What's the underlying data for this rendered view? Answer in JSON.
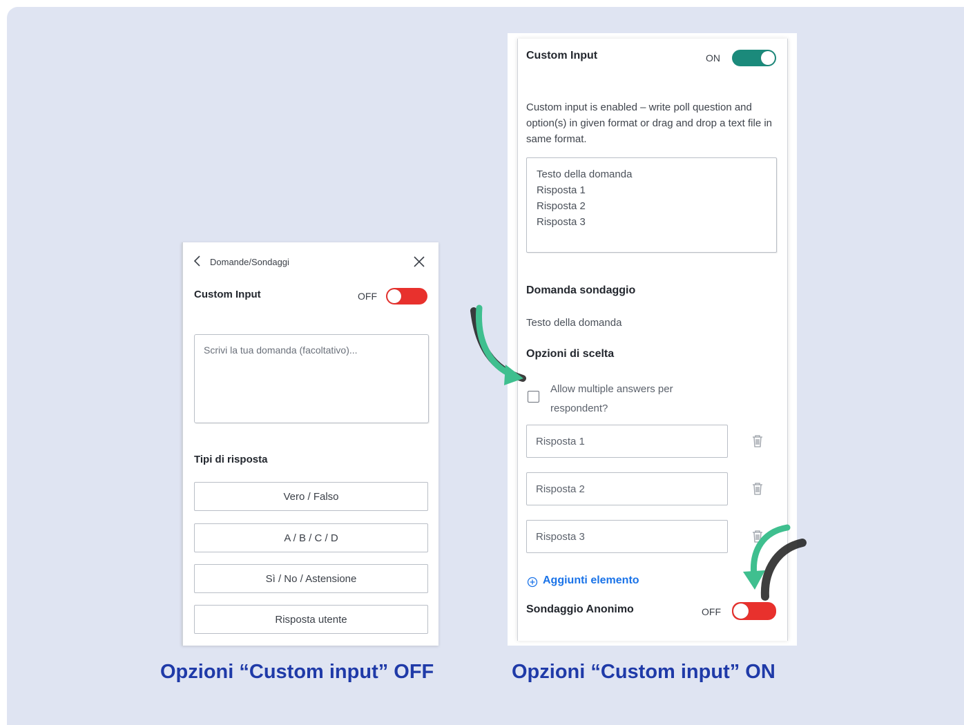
{
  "left_panel": {
    "breadcrumb": "Domande/Sondaggi",
    "custom_input_label": "Custom Input",
    "toggle_state": "OFF",
    "question_placeholder": "Scrivi la tua domanda (facoltativo)...",
    "response_types_heading": "Tipi di risposta",
    "response_types": [
      "Vero / Falso",
      "A / B / C / D",
      "Sì / No / Astensione",
      "Risposta utente"
    ]
  },
  "right_panel": {
    "custom_input_label": "Custom Input",
    "toggle_state": "ON",
    "info_text": "Custom input is enabled – write poll question and option(s) in given format or drag and drop a text file in same format.",
    "format_example": [
      "Testo della domanda",
      "Risposta 1",
      "Risposta 2",
      "Risposta 3"
    ],
    "question_heading": "Domanda sondaggio",
    "question_text": "Testo della domanda",
    "options_heading": "Opzioni di scelta",
    "multiple_answers_label": "Allow multiple answers per respondent?",
    "options": [
      "Risposta 1",
      "Risposta 2",
      "Risposta 3"
    ],
    "add_item_label": "Aggiunti elemento",
    "anonymous_label": "Sondaggio Anonimo",
    "anonymous_state": "OFF"
  },
  "captions": {
    "off": "Opzioni “Custom input” OFF",
    "on": "Opzioni “Custom input” ON"
  },
  "colors": {
    "background": "#dfe4f2",
    "toggle_off": "#e8312d",
    "toggle_on": "#1b8a7b",
    "caption": "#1f3aa8",
    "link": "#1a73e8",
    "arrow": "#3fbf8f"
  }
}
